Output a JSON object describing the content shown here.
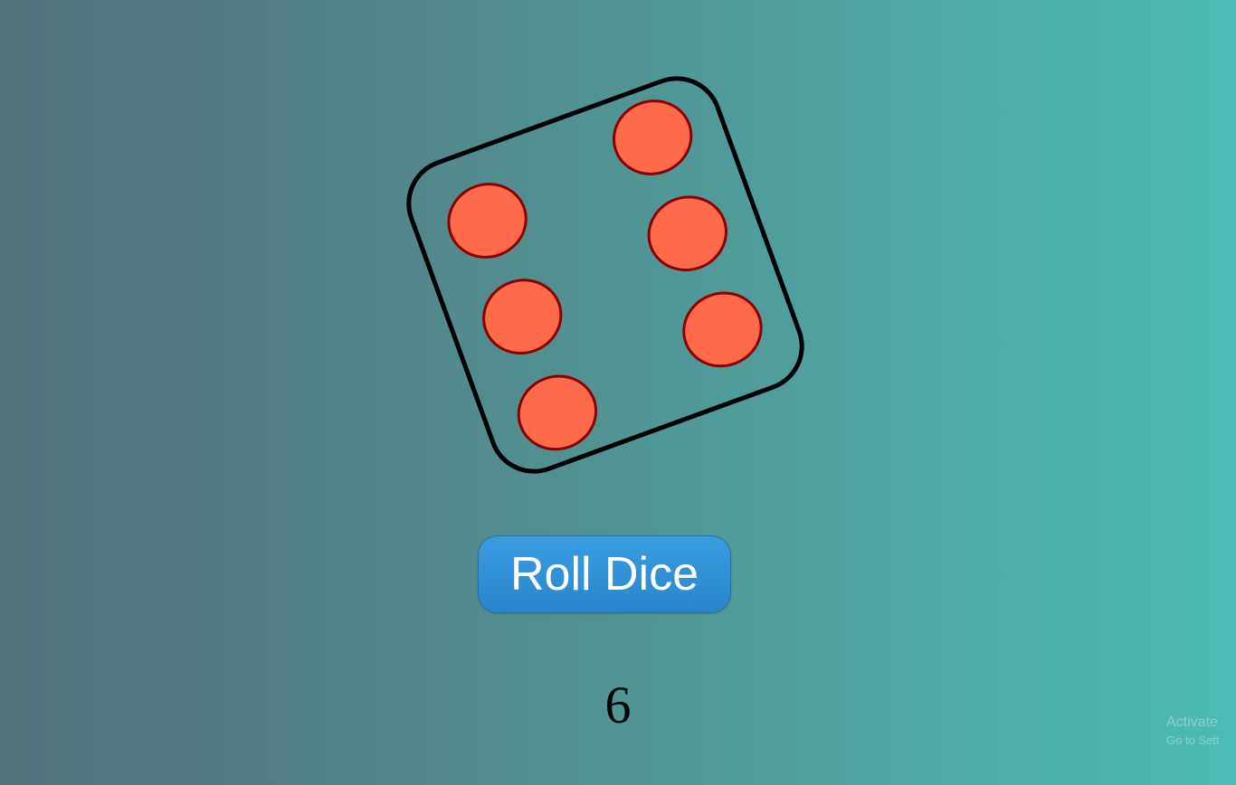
{
  "game": {
    "button_label": "Roll Dice",
    "result": "6",
    "die_face_value": 6
  },
  "watermark": {
    "line1": "Activate",
    "line2": "Go to Sett"
  },
  "colors": {
    "die_outline": "#000000",
    "pip_fill": "#ff6b4a",
    "pip_stroke": "#8b0000",
    "button_bg": "#2f8fd6",
    "button_text": "#ffffff",
    "background_left": "#536f7a",
    "background_right": "#4dbcb4"
  }
}
